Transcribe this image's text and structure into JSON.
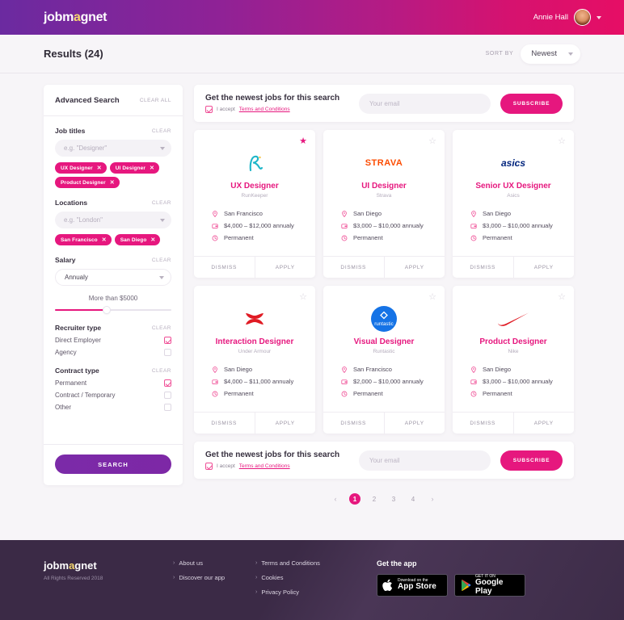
{
  "header": {
    "logo": "jobmagnet",
    "user_name": "Annie Hall",
    "avatar_icon": "user-avatar",
    "chevron_icon": "chevron-down-icon"
  },
  "results": {
    "title": "Results (24)",
    "sort_label": "SORT BY",
    "sort_value": "Newest",
    "sort_options": [
      "Newest"
    ]
  },
  "sidebar": {
    "title": "Advanced Search",
    "clear_all": "CLEAR ALL",
    "clear": "CLEAR",
    "job_titles": {
      "label": "Job titles",
      "placeholder": "e.g. \"Designer\"",
      "tags": [
        "UX Designer",
        "UI Designer",
        "Product Designer"
      ]
    },
    "locations": {
      "label": "Locations",
      "placeholder": "e.g. \"London\"",
      "tags": [
        "San Francisco",
        "San Diego"
      ]
    },
    "salary": {
      "label": "Salary",
      "period": "Annualy",
      "range_text": "More than $5000",
      "fill_percent": 42
    },
    "recruiter_type": {
      "label": "Recruiter type",
      "options": [
        {
          "label": "Direct Employer",
          "checked": true
        },
        {
          "label": "Agency",
          "checked": false
        }
      ]
    },
    "contract_type": {
      "label": "Contract type",
      "options": [
        {
          "label": "Permanent",
          "checked": true
        },
        {
          "label": "Contract / Temporary",
          "checked": false
        },
        {
          "label": "Other",
          "checked": false
        }
      ]
    },
    "search_button": "SEARCH"
  },
  "subscribe": {
    "title": "Get the newest jobs for this search",
    "accept_prefix": "I accept ",
    "accept_link": "Terms and Conditions",
    "email_placeholder": "Your email",
    "email_value": "",
    "button": "SUBSCRIBE",
    "checkbox_checked": true
  },
  "cards": [
    {
      "logo": "runkeeper-logo",
      "title": "UX Designer",
      "company": "RunKeeper",
      "location": "San Francisco",
      "salary": "$4,000 – $12,000 annualy",
      "contract": "Permanent",
      "starred": true,
      "dismiss": "DISMISS",
      "apply": "APPLY"
    },
    {
      "logo": "strava-logo",
      "title": "UI Designer",
      "company": "Strava",
      "location": "San Diego",
      "salary": "$3,000 – $10,000 annualy",
      "contract": "Permanent",
      "starred": false,
      "dismiss": "DISMISS",
      "apply": "APPLY"
    },
    {
      "logo": "asics-logo",
      "title": "Senior UX Designer",
      "company": "Asics",
      "location": "San Diego",
      "salary": "$3,000 – $10,000 annualy",
      "contract": "Permanent",
      "starred": false,
      "dismiss": "DISMISS",
      "apply": "APPLY"
    },
    {
      "logo": "under-armour-logo",
      "title": "Interaction Designer",
      "company": "Under Armour",
      "location": "San Diego",
      "salary": "$4,000 – $11,000 annualy",
      "contract": "Permanent",
      "starred": false,
      "dismiss": "DISMISS",
      "apply": "APPLY"
    },
    {
      "logo": "runtastic-logo",
      "title": "Visual Designer",
      "company": "Runtastic",
      "location": "San Francisco",
      "salary": "$2,000 – $10,000 annualy",
      "contract": "Permanent",
      "starred": false,
      "dismiss": "DISMISS",
      "apply": "APPLY"
    },
    {
      "logo": "nike-logo",
      "title": "Product Designer",
      "company": "Nike",
      "location": "San Diego",
      "salary": "$3,000 – $10,000 annualy",
      "contract": "Permanent",
      "starred": false,
      "dismiss": "DISMISS",
      "apply": "APPLY"
    }
  ],
  "pagination": {
    "prev_icon": "chevron-left-icon",
    "next_icon": "chevron-right-icon",
    "pages": [
      "1",
      "2",
      "3",
      "4"
    ],
    "current": "1"
  },
  "footer": {
    "logo": "jobmagnet",
    "copyright": "All Rights Reserved 2018",
    "col1": [
      "About us",
      "Discover our app"
    ],
    "col2": [
      "Terms and Conditions",
      "Cookies",
      "Privacy Policy"
    ],
    "app_title": "Get the app",
    "appstore_small": "Download on the",
    "appstore_big": "App Store",
    "googleplay_small": "GET IT ON",
    "googleplay_big": "Google Play"
  },
  "colors": {
    "pink": "#e6177e",
    "purple": "#7b2aa8",
    "footer_bg": "#3b2a46",
    "page_bg": "#f7f5f8"
  }
}
